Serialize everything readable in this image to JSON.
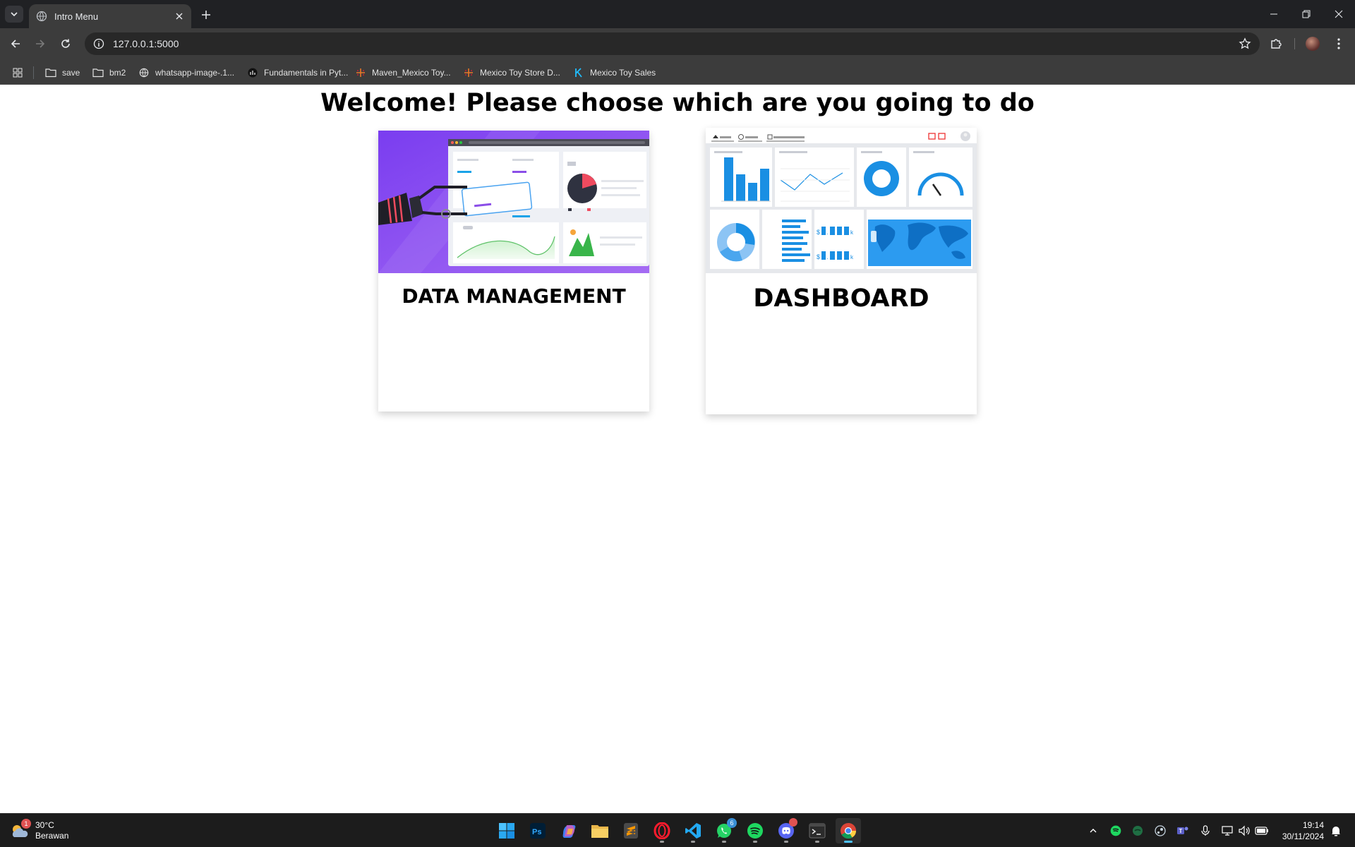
{
  "browser": {
    "tab_title": "Intro Menu",
    "url": "127.0.0.1:5000",
    "bookmarks": [
      {
        "label": "save",
        "icon": "folder-icon"
      },
      {
        "label": "bm2",
        "icon": "folder-icon"
      },
      {
        "label": "whatsapp-image-.1...",
        "icon": "globe-icon"
      },
      {
        "label": "Fundamentals in Pyt...",
        "icon": "site-icon"
      },
      {
        "label": "Maven_Mexico Toy...",
        "icon": "tableau-icon"
      },
      {
        "label": "Mexico Toy Store D...",
        "icon": "tableau-icon"
      },
      {
        "label": "Mexico Toy Sales",
        "icon": "kaggle-icon"
      }
    ]
  },
  "page": {
    "heading": "Welcome! Please choose which are you going to do",
    "cards": [
      {
        "label": "DATA MANAGEMENT",
        "image": "data-management-illustration"
      },
      {
        "label": "DASHBOARD",
        "image": "dashboard-illustration"
      }
    ],
    "dashboard_thumb": {
      "values": [
        "$",
        ".",
        "k",
        "$",
        ".",
        "k"
      ]
    }
  },
  "taskbar": {
    "weather": {
      "temp": "30°C",
      "condition": "Berawan",
      "badge": "1"
    },
    "apps": [
      "start",
      "photoshop",
      "copilot",
      "file-explorer",
      "sublime-text",
      "opera",
      "vscode",
      "whatsapp",
      "spotify",
      "discord",
      "terminal",
      "chrome"
    ],
    "whatsapp_badge": "6",
    "time": "19:14",
    "date": "30/11/2024"
  },
  "colors": {
    "chrome_dark": "#202124",
    "chrome_toolbar": "#3c3c3c",
    "accent_blue": "#1a8fe3",
    "purple": "#8b4ee8"
  }
}
